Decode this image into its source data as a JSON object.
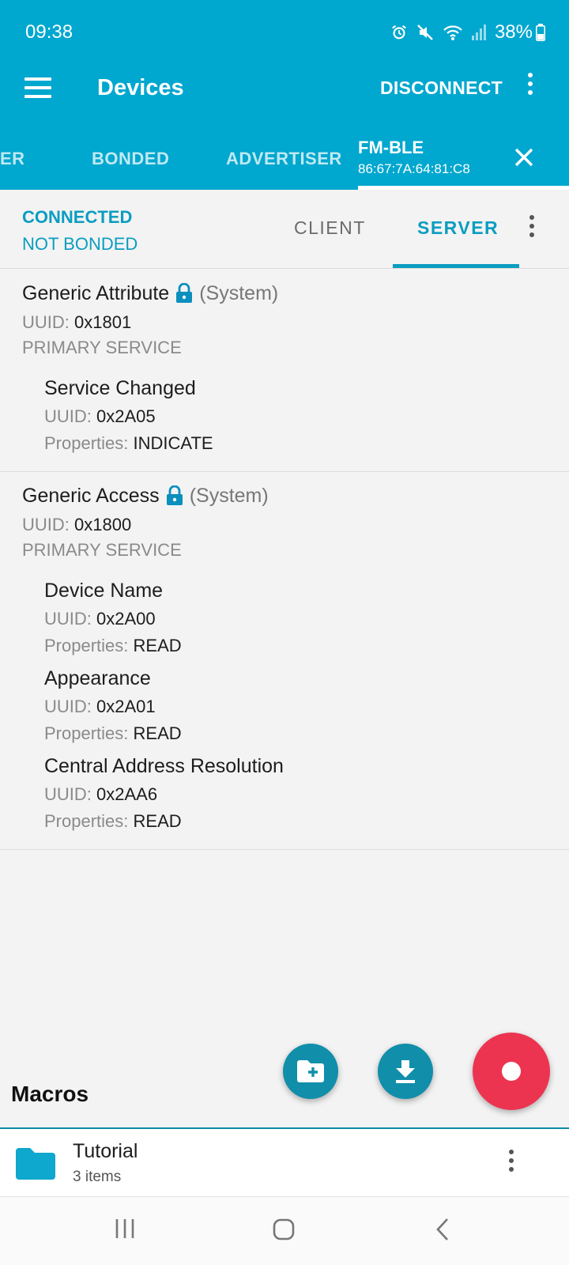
{
  "status_bar": {
    "time": "09:38",
    "battery": "38%",
    "icons": [
      "alarm-icon",
      "mute-icon",
      "wifi-icon",
      "signal-icon",
      "battery-icon"
    ]
  },
  "toolbar": {
    "title": "Devices",
    "disconnect_label": "DISCONNECT"
  },
  "device_tabs": {
    "partial_tab": "ER",
    "bonded": "BONDED",
    "advertiser": "ADVERTISER",
    "active_device_name": "FM-BLE",
    "active_device_mac": "86:67:7A:64:81:C8"
  },
  "connection": {
    "state": "CONNECTED",
    "bond_state": "NOT BONDED",
    "tabs": [
      "CLIENT",
      "SERVER"
    ],
    "selected_tab": "SERVER"
  },
  "services": [
    {
      "name": "Generic Attribute",
      "tag": "(System)",
      "uuid_label": "UUID:",
      "uuid": "0x1801",
      "type": "PRIMARY SERVICE",
      "characteristics": [
        {
          "name": "Service Changed",
          "uuid_label": "UUID:",
          "uuid": "0x2A05",
          "props_label": "Properties:",
          "properties": "INDICATE"
        }
      ]
    },
    {
      "name": "Generic Access",
      "tag": "(System)",
      "uuid_label": "UUID:",
      "uuid": "0x1800",
      "type": "PRIMARY SERVICE",
      "characteristics": [
        {
          "name": "Device Name",
          "uuid_label": "UUID:",
          "uuid": "0x2A00",
          "props_label": "Properties:",
          "properties": "READ"
        },
        {
          "name": "Appearance",
          "uuid_label": "UUID:",
          "uuid": "0x2A01",
          "props_label": "Properties:",
          "properties": "READ"
        },
        {
          "name": "Central Address Resolution",
          "uuid_label": "UUID:",
          "uuid": "0x2AA6",
          "props_label": "Properties:",
          "properties": "READ"
        }
      ]
    }
  ],
  "macros": {
    "title": "Macros",
    "items": [
      {
        "name": "Tutorial",
        "count": "3 items"
      }
    ]
  },
  "colors": {
    "primary": "#00a7cf",
    "accent": "#0b9dc1",
    "fab": "#118eaa",
    "record": "#ec3451"
  }
}
